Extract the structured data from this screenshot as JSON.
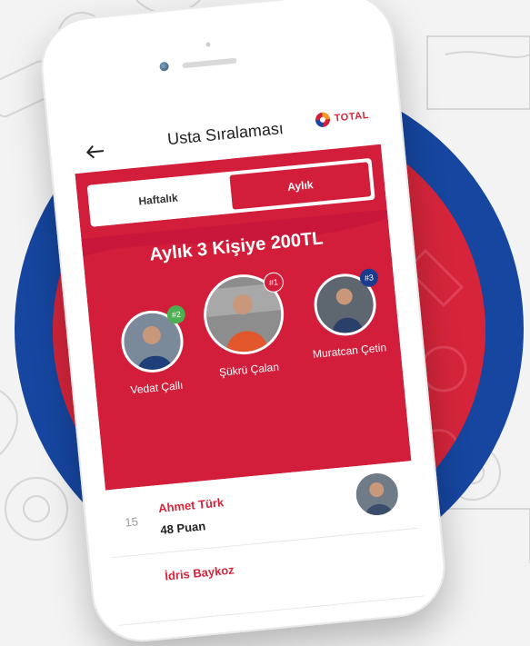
{
  "header": {
    "title": "Usta Sıralaması",
    "brand": "TOTAL",
    "back_icon": "arrow-left-icon"
  },
  "tabs": [
    {
      "label": "Haftalık",
      "active": false
    },
    {
      "label": "Aylık",
      "active": true
    }
  ],
  "prize_text": "Aylık 3 Kişiye 200TL",
  "podium": [
    {
      "rank_badge": "#2",
      "name": "Vedat Çallı",
      "badge_color": "#4caf50"
    },
    {
      "rank_badge": "#1",
      "name": "Şükrü Çalan",
      "badge_color": "#d21e3a"
    },
    {
      "rank_badge": "#3",
      "name": "Muratcan Çetin",
      "badge_color": "#1b3c8c"
    }
  ],
  "leaderboard": [
    {
      "rank": "15",
      "name": "Ahmet Türk",
      "score": "48 Puan"
    },
    {
      "rank": "",
      "name": "İdris Baykoz",
      "score": ""
    }
  ],
  "colors": {
    "brand_red": "#d21e3a",
    "ring_blue": "#1646a0"
  }
}
